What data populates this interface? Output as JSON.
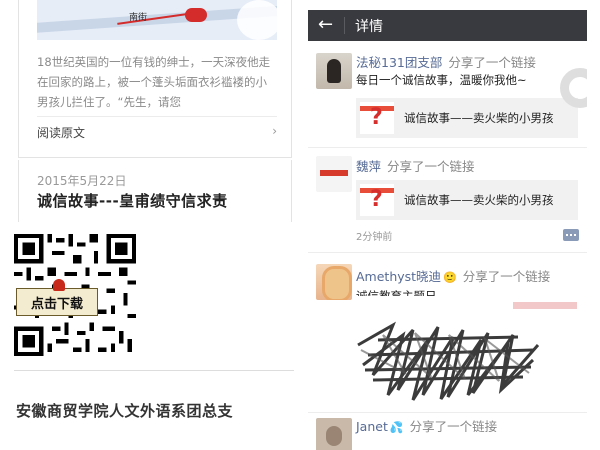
{
  "article": {
    "excerpt": "18世纪英国的一位有钱的绅士，一天深夜他走在回家的路上，被一个蓬头垢面衣衫褴褛的小男孩儿拦住了。“先生，请您",
    "read_more": "阅读原文",
    "date": "2015年5月22日",
    "title": "诚信故事---皇甫绩守信求责",
    "qr_label": "点击下载",
    "footer": "安徽商贸学院人文外语系团总支"
  },
  "detail": {
    "title": "详情",
    "posts": [
      {
        "user": "法秘131团支部",
        "action": "分享了一个链接",
        "text": "每日一个诚信故事，温暖你我他~",
        "link_title": "诚信故事——卖火柴的小男孩"
      },
      {
        "user": "魏萍",
        "action": "分享了一个链接",
        "link_title": "诚信故事——卖火柴的小男孩",
        "time": "2分钟前"
      },
      {
        "user": "Amethyst晓迪",
        "action": "分享了一个链接",
        "text": "诚信教育主题日"
      },
      {
        "user": "Janet",
        "action": "分享了一个链接"
      }
    ]
  },
  "colors": {
    "topbar": "#393a3f",
    "username": "#576b95",
    "link_bg": "#f1f1f1"
  },
  "icons": [
    "back-arrow-icon",
    "chevron-right-icon",
    "comment-icon",
    "qr-code",
    "question-mark-thumb"
  ]
}
